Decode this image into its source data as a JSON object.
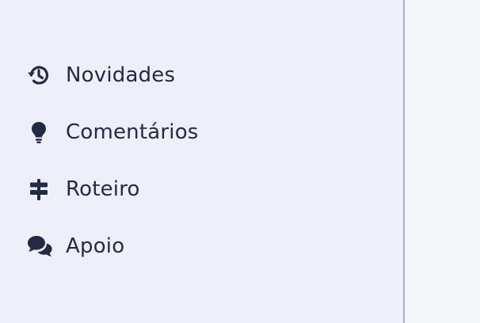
{
  "sidebar": {
    "items": [
      {
        "label": "Novidades",
        "icon": "history-icon"
      },
      {
        "label": "Comentários",
        "icon": "lightbulb-icon"
      },
      {
        "label": "Roteiro",
        "icon": "signpost-icon"
      },
      {
        "label": "Apoio",
        "icon": "chat-bubbles-icon"
      }
    ]
  },
  "colors": {
    "sidebar_bg": "#eeeff8",
    "content_bg": "#f5f6fa",
    "divider": "#a9aed2",
    "text": "#232a44"
  }
}
